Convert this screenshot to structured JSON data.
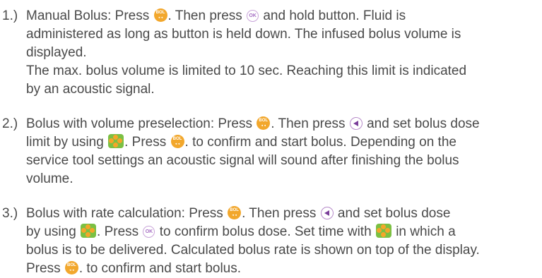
{
  "items": [
    {
      "number": "1.)",
      "lines": [
        [
          "Manual Bolus: Press ",
          "[bol-icon]",
          ". Then press ",
          "[ok-icon]",
          " and hold button. Fluid is"
        ],
        [
          "administered as long as button is held down. The infused bolus volume is"
        ],
        [
          "displayed."
        ],
        [
          "The max. bolus volume is limited to 10 sec. Reaching this limit is  indicated"
        ],
        [
          "by an acoustic signal."
        ]
      ]
    },
    {
      "number": "2.)",
      "lines": [
        [
          "Bolus with volume preselection: Press ",
          "[bol-icon]",
          ". Then press ",
          "[left-arrow-icon]",
          " and set bolus dose"
        ],
        [
          "limit by using ",
          "[arrow-keys-icon]",
          ". Press ",
          "[bol-icon]",
          ". to confirm and start bolus. Depending on the"
        ],
        [
          "service tool settings an acoustic signal will sound after finishing the bolus"
        ],
        [
          "volume."
        ]
      ]
    },
    {
      "number": "3.)",
      "lines": [
        [
          "Bolus with rate calculation: Press ",
          "[bol-icon]",
          ". Then press ",
          "[left-arrow-icon]",
          " and set bolus dose"
        ],
        [
          "by using ",
          "[arrow-keys-icon]",
          ". Press ",
          "[ok-icon]",
          " to confirm bolus dose. Set time with ",
          "[arrow-keys-icon]",
          " in which a"
        ],
        [
          "bolus is to be delivered. Calculated bolus rate is shown on top of the display."
        ],
        [
          "Press ",
          "[bol-icon]",
          ". to confirm and start bolus."
        ]
      ]
    }
  ]
}
